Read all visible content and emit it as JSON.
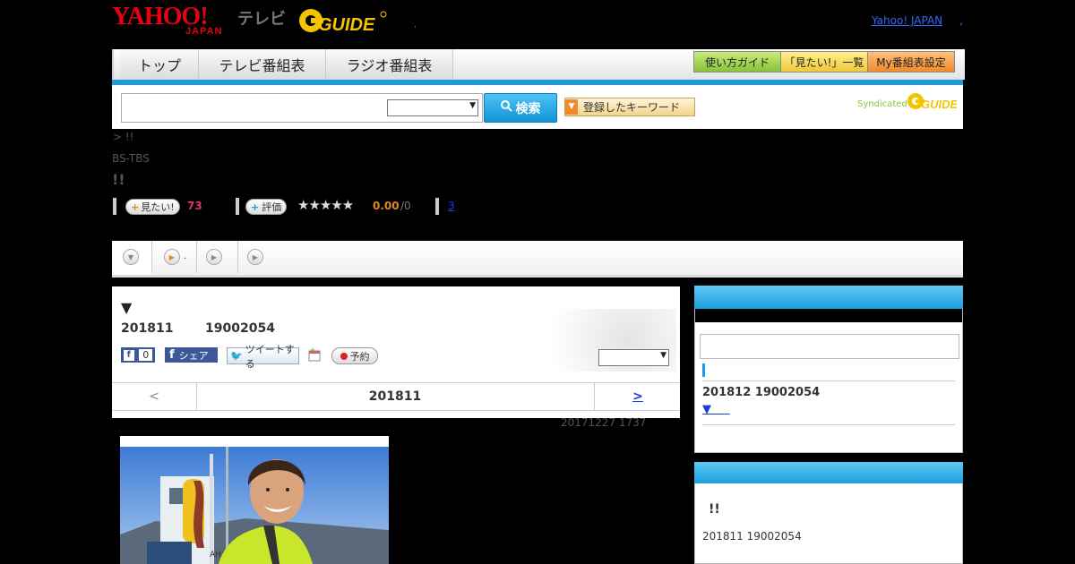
{
  "header": {
    "yahoo_logo_main": "YAHOO!",
    "yahoo_logo_sub": "JAPAN",
    "tv_logo": "テレビ",
    "gguide_logo": "GUIDE",
    "yahoo_japan_link": "Yahoo! JAPAN",
    "dot_a": ",",
    "dot_b": ","
  },
  "nav": {
    "tabs": [
      "トップ",
      "テレビ番組表",
      "ラジオ番組表"
    ],
    "buttons": [
      "使い方ガイド",
      "「見たい!」一覧",
      "My番組表設定"
    ]
  },
  "search": {
    "button_label": "検索",
    "keyword_button": "登録したキーワード",
    "syndicated": "Syndicated"
  },
  "program": {
    "breadcrumb": "> !!",
    "channel": "BS-TBS",
    "title": "!!",
    "want_label": "見たい!",
    "want_count": "73",
    "rate_label": "評価",
    "stars": "★★★★★",
    "rating": "0.00",
    "rating_total": "/0",
    "review_count": "3"
  },
  "tabs": {
    "tab2_suffix": "."
  },
  "main": {
    "arrow": "▼",
    "date": "201811",
    "time_code": "19002054",
    "like_count": "0",
    "share_label": "シェア",
    "tweet_label": "ツイートする",
    "reserve_label": "予約",
    "pager_prev": "<",
    "pager_current": "201811",
    "pager_next": ">",
    "updated": "20171227  1737"
  },
  "sidebar": {
    "next_date": "201812  19002054",
    "next_link": "▼",
    "box2_title": "!!",
    "box2_date": "201811  19002054"
  },
  "colors": {
    "accent_blue": "#1e9be0",
    "yahoo_red": "#e60012",
    "gguide_yellow": "#f5c400",
    "want_count_color": "#e6336e",
    "rating_color": "#e08a1e"
  }
}
